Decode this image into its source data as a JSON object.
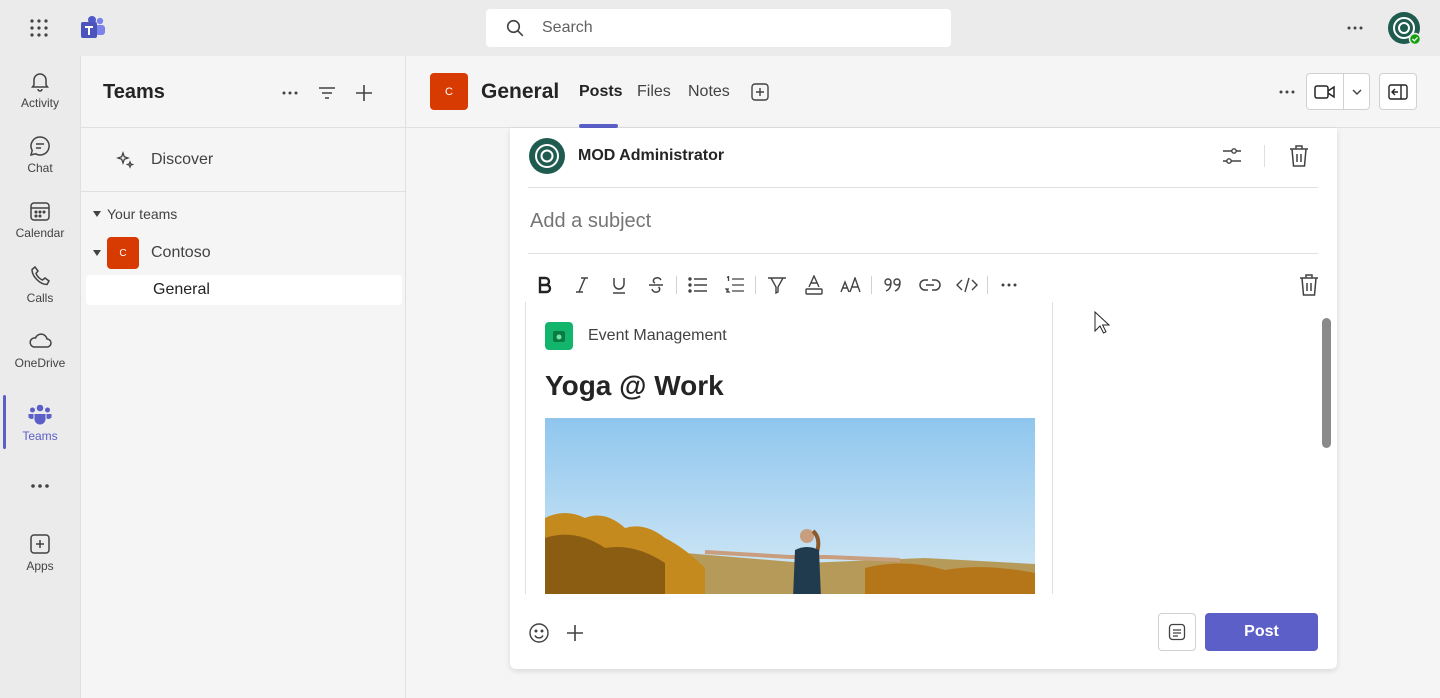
{
  "topbar": {
    "search_placeholder": "Search",
    "icons": [
      "app-launcher-icon",
      "teams-logo-icon",
      "search-icon",
      "more-icon",
      "avatar"
    ]
  },
  "rail": {
    "items": [
      {
        "label": "Activity",
        "icon": "bell-icon"
      },
      {
        "label": "Chat",
        "icon": "chat-icon"
      },
      {
        "label": "Calendar",
        "icon": "calendar-icon"
      },
      {
        "label": "Calls",
        "icon": "phone-icon"
      },
      {
        "label": "OneDrive",
        "icon": "cloud-icon"
      },
      {
        "label": "Teams",
        "icon": "teams-icon",
        "active": true
      },
      {
        "label": "",
        "icon": "more-icon"
      },
      {
        "label": "Apps",
        "icon": "add-app-icon"
      }
    ]
  },
  "panel": {
    "title": "Teams",
    "discover": "Discover",
    "your_teams": "Your teams",
    "team": {
      "avatar": "C",
      "name": "Contoso"
    },
    "channel": "General"
  },
  "header": {
    "channel_avatar": "C",
    "channel_title": "General",
    "tabs": [
      {
        "label": "Posts",
        "active": true
      },
      {
        "label": "Files"
      },
      {
        "label": "Notes"
      }
    ]
  },
  "compose": {
    "author": "MOD Administrator",
    "subject_placeholder": "Add a subject",
    "toolbar": [
      "bold",
      "italic",
      "underline",
      "strikethrough",
      "bulleted-list",
      "numbered-list",
      "highlight",
      "font-color",
      "font-size",
      "quote",
      "link",
      "code",
      "more"
    ],
    "card": {
      "app_name": "Event Management",
      "title": "Yoga @ Work"
    },
    "post_label": "Post"
  },
  "colors": {
    "accent": "#5b5fc7",
    "team_avatar": "#d83b01",
    "app_icon": "#13b46b"
  }
}
